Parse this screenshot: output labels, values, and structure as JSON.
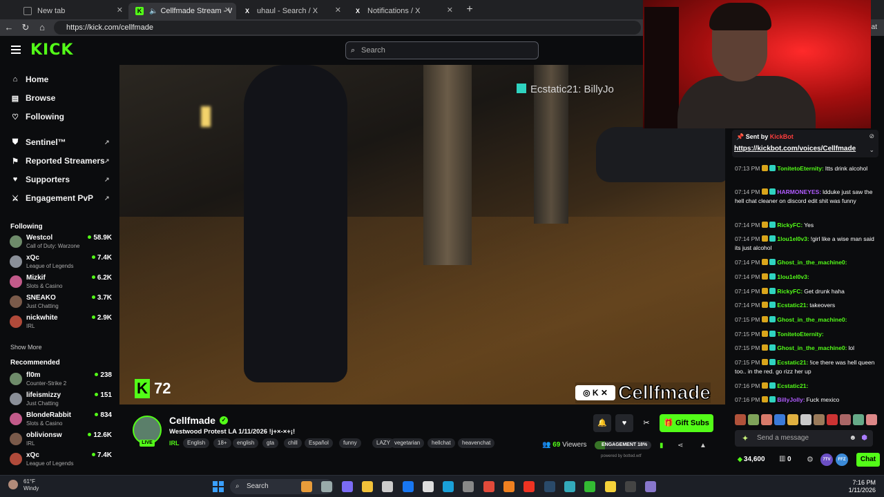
{
  "browser": {
    "tabs": [
      {
        "title": "New tab",
        "active": false
      },
      {
        "title": "Cellfmade Stream - Watch Live",
        "active": true
      },
      {
        "title": "uhaul - Search / X",
        "active": false
      },
      {
        "title": "Notifications / X",
        "active": false
      }
    ],
    "url": "https://kick.com/cellfmade",
    "chat_tab_fragment": "hat"
  },
  "header": {
    "logo": "KICK",
    "search_placeholder": "Search"
  },
  "sidebar": {
    "nav": [
      {
        "label": "Home",
        "icon": "home-icon"
      },
      {
        "label": "Browse",
        "icon": "browse-icon"
      },
      {
        "label": "Following",
        "icon": "heart-icon"
      }
    ],
    "extras": [
      {
        "label": "Sentinel™",
        "icon": "shield-icon"
      },
      {
        "label": "Reported Streamers",
        "icon": "flag-icon"
      },
      {
        "label": "Supporters",
        "icon": "heart-icon"
      },
      {
        "label": "Engagement PvP",
        "icon": "swords-icon"
      }
    ],
    "following_title": "Following",
    "following": [
      {
        "name": "Westcol",
        "category": "Call of Duty: Warzone",
        "viewers": "58.9K"
      },
      {
        "name": "xQc",
        "category": "League of Legends",
        "viewers": "7.4K"
      },
      {
        "name": "Mizkif",
        "category": "Slots & Casino",
        "viewers": "6.2K"
      },
      {
        "name": "SNEAKO",
        "category": "Just Chatting",
        "viewers": "3.7K"
      },
      {
        "name": "nickwhite",
        "category": "IRL",
        "viewers": "2.9K"
      }
    ],
    "show_more": "Show More",
    "recommended_title": "Recommended",
    "recommended": [
      {
        "name": "fl0m",
        "category": "Counter-Strike 2",
        "viewers": "238"
      },
      {
        "name": "lifeismizzy",
        "category": "Just Chatting",
        "viewers": "151"
      },
      {
        "name": "BlondeRabbit",
        "category": "Slots & Casino",
        "viewers": "834"
      },
      {
        "name": "oblivionsw",
        "category": "IRL",
        "viewers": "12.6K"
      },
      {
        "name": "xQc",
        "category": "League of Legends",
        "viewers": "7.4K"
      }
    ]
  },
  "player": {
    "overlay_chat": "Ecstatic21:  BillyJo",
    "kick_counter": "72",
    "handle": "Cellfmade"
  },
  "chat": {
    "pinned_sentby": "Sent by",
    "pinned_bot": "KickBot",
    "pinned_link": "https://kickbot.com/voices/Cellfmade",
    "messages": [
      {
        "time": "07:13 PM",
        "user": "TonitetoEternity:",
        "color": "#53fc18",
        "text": "Itts drink alcohol"
      },
      {
        "time": "07:14 PM",
        "user": "HARMONEYES:",
        "color": "#b05cff",
        "text": "ldduke just saw the hell chat cleaner on discord edit shit was funny"
      },
      {
        "time": "07:14 PM",
        "user": "RickyFC:",
        "color": "#53fc18",
        "text": "Yes"
      },
      {
        "time": "07:14 PM",
        "user": "1lou1el0v3:",
        "color": "#53fc18",
        "text": "!girl like a wise man said its just alcohol"
      },
      {
        "time": "07:14 PM",
        "user": "Ghost_in_the_machine0:",
        "color": "#53fc18",
        "text": ""
      },
      {
        "time": "07:14 PM",
        "user": "1lou1el0v3:",
        "color": "#53fc18",
        "text": ""
      },
      {
        "time": "07:14 PM",
        "user": "RickyFC:",
        "color": "#53fc18",
        "text": "Get drunk haha"
      },
      {
        "time": "07:14 PM",
        "user": "Ecstatic21:",
        "color": "#53fc18",
        "text": "takeovers"
      },
      {
        "time": "07:15 PM",
        "user": "Ghost_in_the_machine0:",
        "color": "#53fc18",
        "text": ""
      },
      {
        "time": "07:15 PM",
        "user": "TonitetoEternity:",
        "color": "#53fc18",
        "text": ""
      },
      {
        "time": "07:15 PM",
        "user": "Ghost_in_the_machine0:",
        "color": "#53fc18",
        "text": "lol"
      },
      {
        "time": "07:15 PM",
        "user": "Ecstatic21:",
        "color": "#53fc18",
        "text": "!ice there was hell queen too.. in the red. go rizz her up"
      },
      {
        "time": "07:16 PM",
        "user": "Ecstatic21:",
        "color": "#53fc18",
        "text": ""
      },
      {
        "time": "07:16 PM",
        "user": "BillyJolly:",
        "color": "#b05cff",
        "text": "Fuck mexico"
      }
    ],
    "input_placeholder": "Send a message",
    "points": "34,600",
    "zero": "0",
    "ext_ttv": "7TV",
    "ext_ffz": "FFZ",
    "chat_button": "Chat"
  },
  "stream": {
    "channel": "Cellfmade",
    "live": "LIVE",
    "title": "Westwood Protest LA 1/11/2026 !j+×-×+¡!",
    "category": "IRL",
    "tags": [
      "English",
      "18+",
      "english",
      "gta",
      "chill",
      "Español",
      "funny",
      "LAZY",
      "vegetarian",
      "hellchat",
      "heavenchat"
    ],
    "gift_subs": "Gift Subs",
    "viewers_count": "69",
    "viewers_label": "Viewers",
    "engagement_label": "ENGAGEMENT 18%",
    "engagement_fraction": 0.18,
    "powered_by": "powered by botted.wtf"
  },
  "taskbar": {
    "temp": "61°F",
    "weather": "Windy",
    "search": "Search",
    "time": "7:16 PM",
    "date": "1/11/2026"
  },
  "colors": {
    "accent": "#53fc18",
    "bg": "#0b0c0e",
    "chrome": "#202124"
  }
}
